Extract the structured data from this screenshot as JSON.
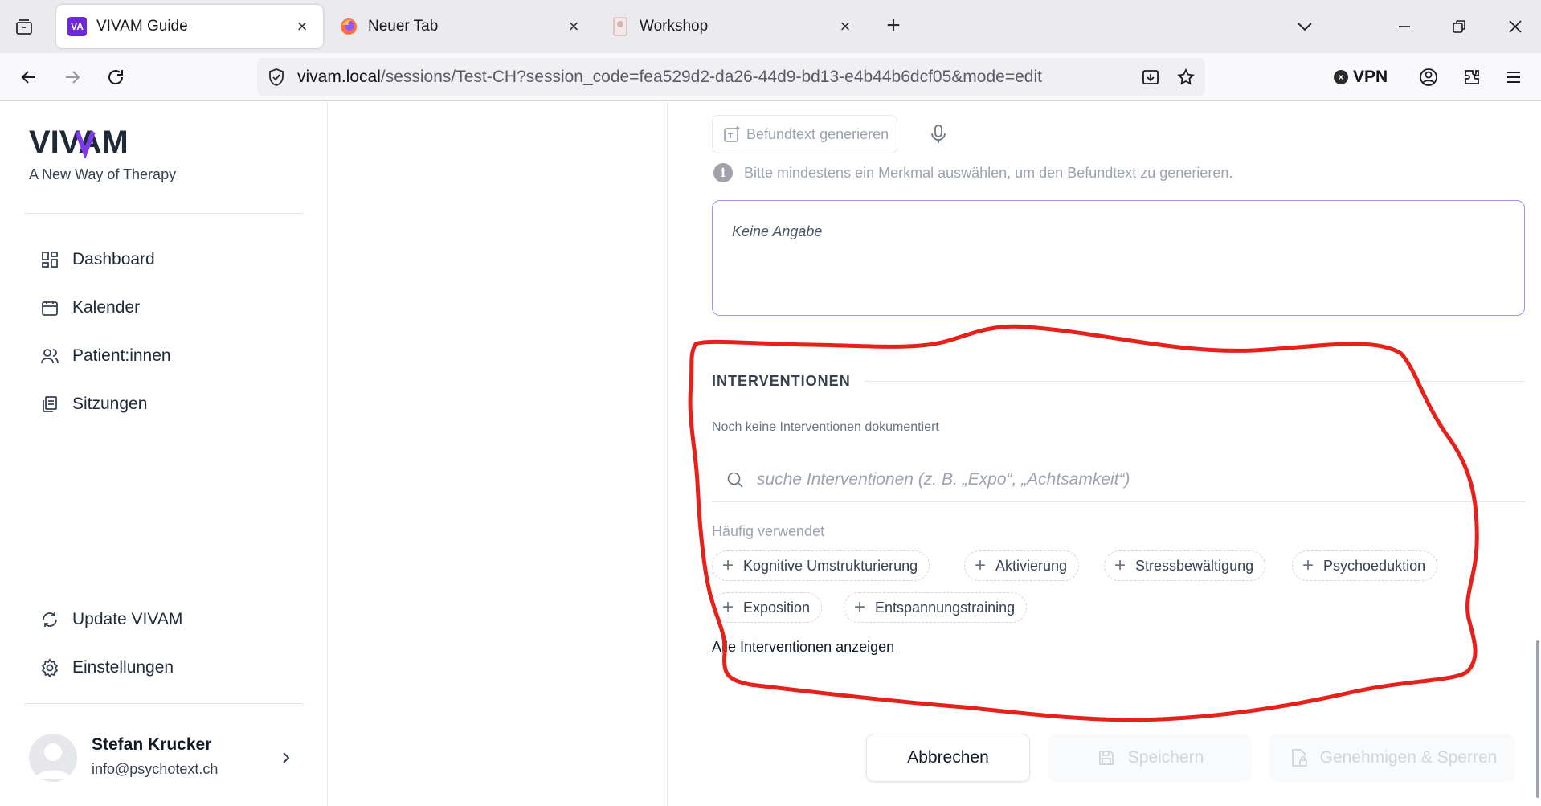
{
  "browser": {
    "tabs": [
      {
        "title": "VIVAM Guide",
        "favicon": "VA",
        "active": true
      },
      {
        "title": "Neuer Tab",
        "active": false
      },
      {
        "title": "Workshop",
        "active": false
      }
    ],
    "url_host": "vivam.local",
    "url_path": "/sessions/Test-CH?session_code=fea529d2-da26-44d9-bd13-e4b44b6dcf05&mode=edit",
    "vpn_label": "VPN"
  },
  "sidebar": {
    "logo": "VIVAM",
    "tagline": "A New Way of Therapy",
    "nav": [
      {
        "label": "Dashboard",
        "icon": "dashboard-icon"
      },
      {
        "label": "Kalender",
        "icon": "calendar-icon"
      },
      {
        "label": "Patient:innen",
        "icon": "users-icon"
      },
      {
        "label": "Sitzungen",
        "icon": "sessions-icon"
      }
    ],
    "bottom_nav": [
      {
        "label": "Update VIVAM",
        "icon": "refresh-icon"
      },
      {
        "label": "Einstellungen",
        "icon": "gear-icon"
      }
    ],
    "user": {
      "name": "Stefan Krucker",
      "email": "info@psychotext.ch"
    }
  },
  "main": {
    "generate_label": "Befundtext generieren",
    "hint": "Bitte mindestens ein Merkmal auswählen, um den Befundtext zu generieren.",
    "textbox_value": "Keine Angabe",
    "interventions": {
      "title": "INTERVENTIONEN",
      "empty_note": "Noch keine Interventionen dokumentiert",
      "search_placeholder": "suche Interventionen (z. B. „Expo“, „Achtsamkeit“)",
      "frequent_label": "Häufig verwendet",
      "chips": [
        "Kognitive Umstrukturierung",
        "Aktivierung",
        "Stressbewältigung",
        "Psychoeduktion",
        "Exposition",
        "Entspannungstraining"
      ],
      "show_all": "Alle Interventionen anzeigen"
    },
    "actions": {
      "cancel": "Abbrechen",
      "save": "Speichern",
      "approve": "Genehmigen & Sperren"
    }
  },
  "colors": {
    "accent": "#7c3aed",
    "annotation": "#e8201a",
    "disabled_text": "#d1d5db"
  }
}
